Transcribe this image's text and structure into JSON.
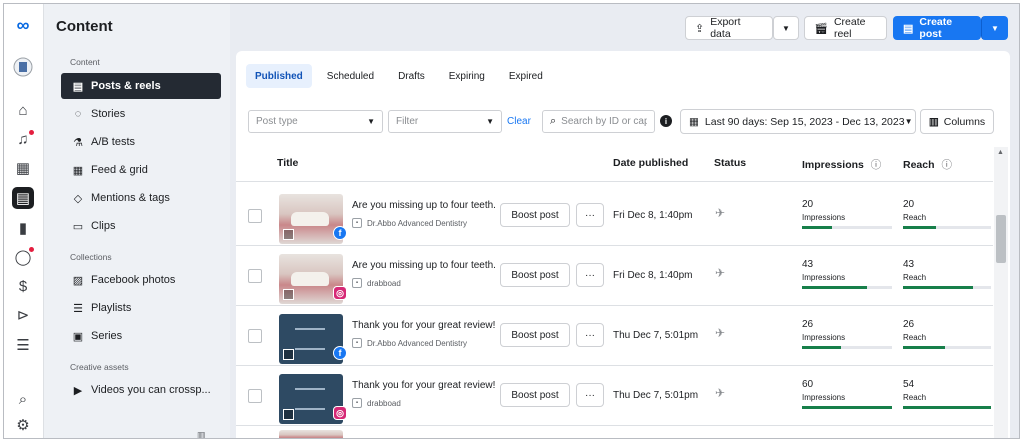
{
  "header": {
    "title": "Content",
    "export_label": "Export data",
    "create_reel_label": "Create reel",
    "create_post_label": "Create post"
  },
  "sidebar": {
    "sections": {
      "content": "Content",
      "collections": "Collections",
      "creative": "Creative assets"
    },
    "items": [
      {
        "label": "Posts & reels",
        "icon": "posts-reels-icon",
        "selected": true
      },
      {
        "label": "Stories",
        "icon": "stories-icon"
      },
      {
        "label": "A/B tests",
        "icon": "flask-icon"
      },
      {
        "label": "Feed & grid",
        "icon": "grid-icon"
      },
      {
        "label": "Mentions & tags",
        "icon": "tag-icon"
      },
      {
        "label": "Clips",
        "icon": "clips-icon"
      },
      {
        "label": "Facebook photos",
        "icon": "photos-icon"
      },
      {
        "label": "Playlists",
        "icon": "playlist-icon"
      },
      {
        "label": "Series",
        "icon": "series-icon"
      },
      {
        "label": "Videos you can crossp...",
        "icon": "video-icon"
      }
    ]
  },
  "tabs": [
    {
      "label": "Published",
      "selected": true
    },
    {
      "label": "Scheduled"
    },
    {
      "label": "Drafts"
    },
    {
      "label": "Expiring"
    },
    {
      "label": "Expired"
    }
  ],
  "filters": {
    "post_type_placeholder": "Post type",
    "filter_placeholder": "Filter",
    "clear_label": "Clear",
    "search_placeholder": "Search by ID or cap",
    "date_range": "Last 90 days: Sep 15, 2023 - Dec 13, 2023",
    "columns_label": "Columns"
  },
  "table": {
    "headers": {
      "title": "Title",
      "date": "Date published",
      "status": "Status",
      "impressions": "Impressions",
      "reach": "Reach"
    },
    "rows": [
      {
        "caption": "Are you missing up to four teeth...",
        "account": "Dr.Abbo Advanced Dentistry",
        "platform": "facebook",
        "thumb": "teeth",
        "boost_label": "Boost post",
        "more_label": "···",
        "date": "Fri Dec 8, 1:40pm",
        "impressions": "20",
        "impressions_label": "Impressions",
        "impressions_fill": 0.33,
        "reach": "20",
        "reach_label": "Reach",
        "reach_fill": 0.37
      },
      {
        "caption": "Are you missing up to four teeth...",
        "account": "drabboad",
        "platform": "instagram",
        "thumb": "teeth",
        "boost_label": "Boost post",
        "more_label": "···",
        "date": "Fri Dec 8, 1:40pm",
        "impressions": "43",
        "impressions_label": "Impressions",
        "impressions_fill": 0.72,
        "reach": "43",
        "reach_label": "Reach",
        "reach_fill": 0.8
      },
      {
        "caption": "Thank you for your great review!...",
        "account": "Dr.Abbo Advanced Dentistry",
        "platform": "facebook",
        "thumb": "review",
        "boost_label": "Boost post",
        "more_label": "···",
        "date": "Thu Dec 7, 5:01pm",
        "impressions": "26",
        "impressions_label": "Impressions",
        "impressions_fill": 0.43,
        "reach": "26",
        "reach_label": "Reach",
        "reach_fill": 0.48
      },
      {
        "caption": "Thank you for your great review!...",
        "account": "drabboad",
        "platform": "instagram",
        "thumb": "review",
        "boost_label": "Boost post",
        "more_label": "···",
        "date": "Thu Dec 7, 5:01pm",
        "impressions": "60",
        "impressions_label": "Impressions",
        "impressions_fill": 1.0,
        "reach": "54",
        "reach_label": "Reach",
        "reach_fill": 1.0
      }
    ]
  },
  "colors": {
    "accent": "#1877f2",
    "bar_fill": "#177f4a",
    "selected_nav": "#242a33"
  }
}
